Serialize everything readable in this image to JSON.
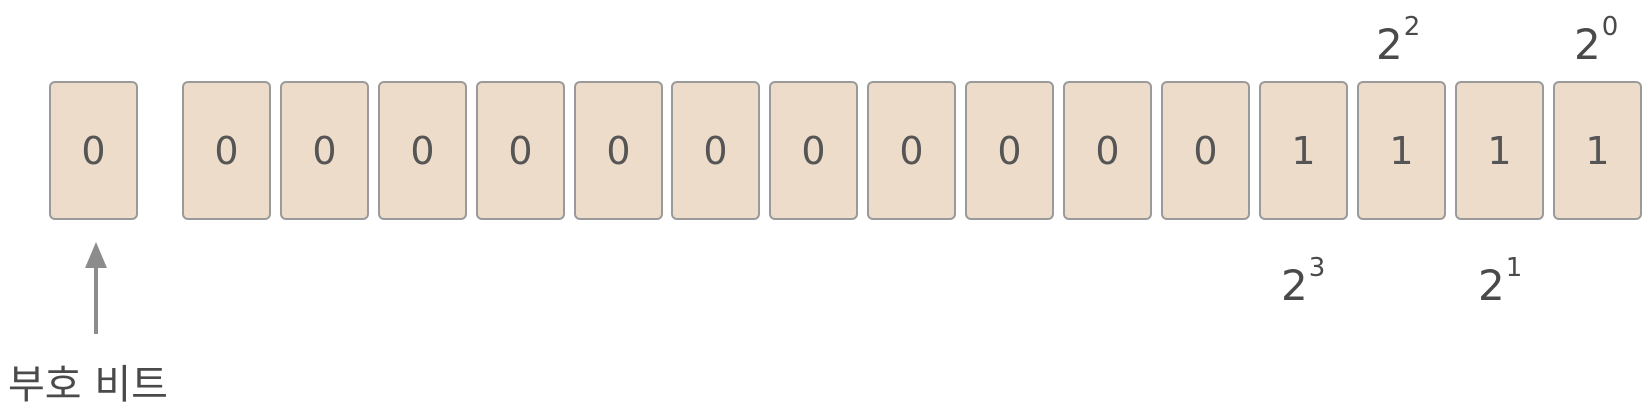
{
  "sign_bit": {
    "value": "0",
    "label": "부호 비트"
  },
  "bits": [
    "0",
    "0",
    "0",
    "0",
    "0",
    "0",
    "0",
    "0",
    "0",
    "0",
    "0",
    "1",
    "1",
    "1",
    "1"
  ],
  "powers": [
    {
      "base": "2",
      "exp": "2"
    },
    {
      "base": "2",
      "exp": "0"
    },
    {
      "base": "2",
      "exp": "3"
    },
    {
      "base": "2",
      "exp": "1"
    }
  ],
  "colors": {
    "cell_fill": "#ecdcc9",
    "cell_border": "#9a9a9a",
    "text": "#4a4a4a",
    "arrow": "#8c8c8c"
  }
}
